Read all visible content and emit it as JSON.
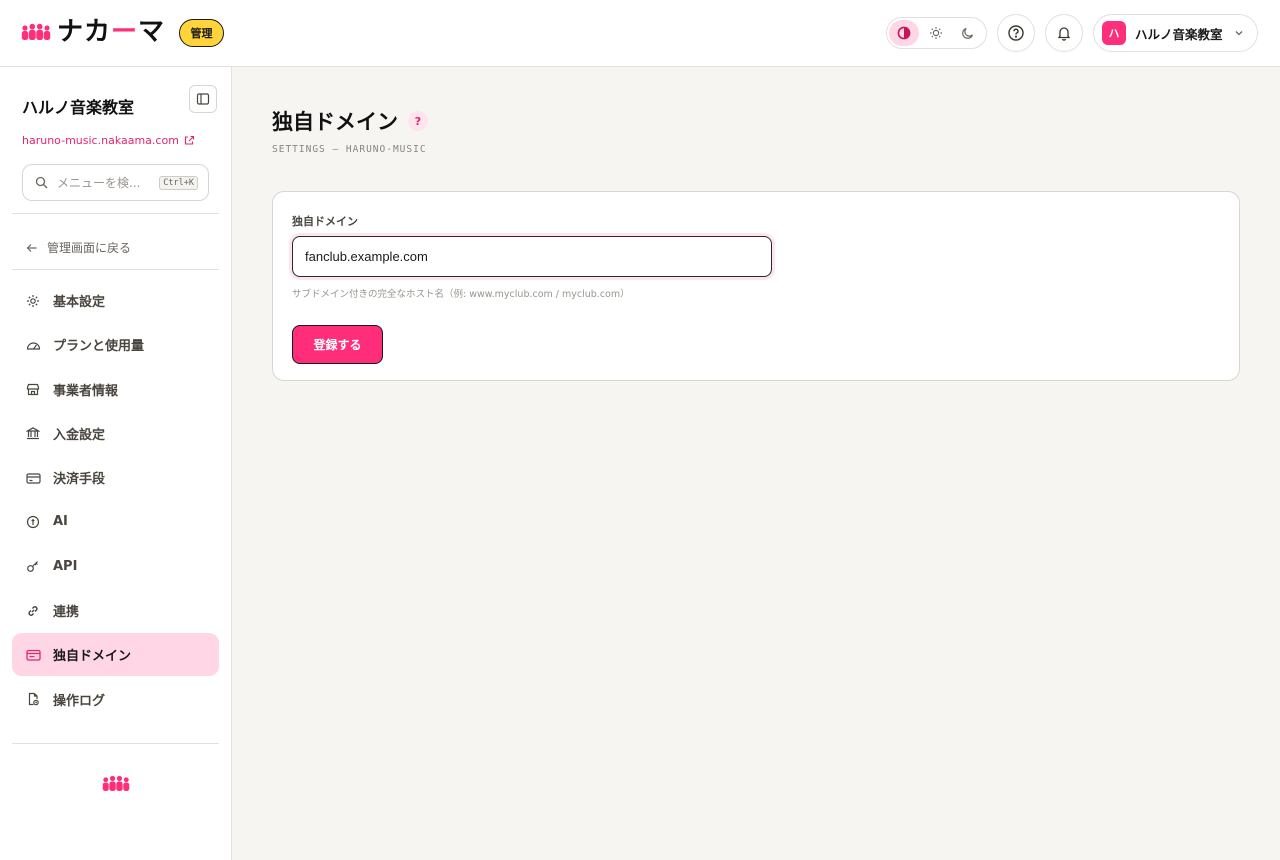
{
  "header": {
    "logo_text_prefix": "ナカ",
    "logo_text_dash": "ー",
    "logo_text_suffix": "マ",
    "admin_badge": "管理",
    "theme_modes": [
      "contrast-icon",
      "sun-icon",
      "moon-icon"
    ],
    "active_theme": "contrast-icon",
    "account": {
      "avatar_letter": "ハ",
      "name": "ハルノ音楽教室"
    }
  },
  "sidebar": {
    "org_name": "ハルノ音楽教室",
    "org_url": "haruno-music.nakaama.com",
    "search": {
      "placeholder": "メニューを検...",
      "shortcut": "Ctrl+K"
    },
    "back_label": "管理画面に戻る",
    "items": [
      {
        "label": "基本設定",
        "icon": "gear-icon"
      },
      {
        "label": "プランと使用量",
        "icon": "gauge-icon"
      },
      {
        "label": "事業者情報",
        "icon": "store-icon"
      },
      {
        "label": "入金設定",
        "icon": "bank-icon"
      },
      {
        "label": "決済手段",
        "icon": "credit-card-icon"
      },
      {
        "label": "AI",
        "icon": "ai-icon"
      },
      {
        "label": "API",
        "icon": "key-icon"
      },
      {
        "label": "連携",
        "icon": "link-icon"
      },
      {
        "label": "独自ドメイン",
        "icon": "domain-card-icon",
        "active": true
      },
      {
        "label": "操作ログ",
        "icon": "log-file-icon"
      }
    ]
  },
  "main": {
    "title": "独自ドメイン",
    "help": "?",
    "subtitle": "SETTINGS — HARUNO-MUSIC",
    "form": {
      "label": "独自ドメイン",
      "value": "fanclub.example.com",
      "hint": "サブドメイン付きの完全なホスト名（例: www.myclub.com / myclub.com）",
      "submit": "登録する"
    }
  },
  "colors": {
    "brand": "#ff2d7a",
    "active_bg": "#ffd6e6",
    "badge": "#ffd43b",
    "page_bg": "#f6f5f2"
  }
}
